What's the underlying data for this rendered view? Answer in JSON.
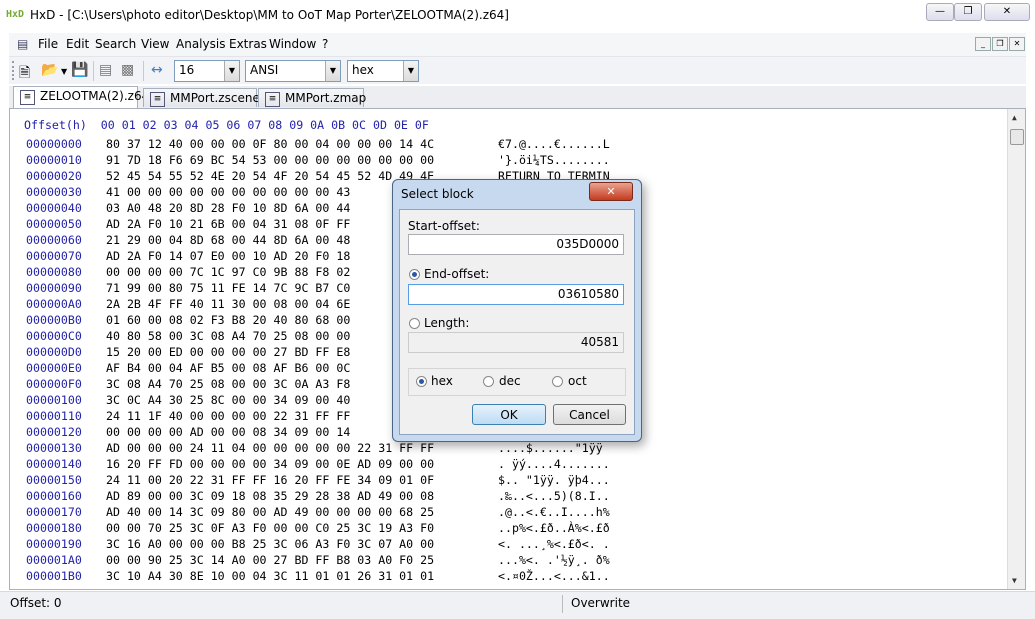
{
  "window": {
    "app_icon": "HxD",
    "title": "HxD - [C:\\Users\\photo editor\\Desktop\\MM to OoT Map Porter\\ZELOOTMA(2).z64]",
    "controls": [
      "minimize-icon",
      "restore-icon",
      "close-icon"
    ]
  },
  "menu": {
    "items": [
      "File",
      "Edit",
      "Search",
      "View",
      "Analysis",
      "Extras",
      "Window",
      "?"
    ]
  },
  "toolbar": {
    "bytes_per_row": "16",
    "charset": "ANSI",
    "offset_base": "hex"
  },
  "tabs": [
    {
      "label": "ZELOOTMA(2).z64",
      "active": true
    },
    {
      "label": "MMPort.zscene",
      "active": false
    },
    {
      "label": "MMPort.zmap",
      "active": false
    }
  ],
  "editor": {
    "header": "Offset(h)  00 01 02 03 04 05 06 07 08 09 0A 0B 0C 0D 0E 0F",
    "rows": [
      {
        "offset": "00000000",
        "hex": "80 37 12 40 00 00 00 0F 80 00 04 00 00 00 14 4C",
        "ascii": "€7.@....€......L"
      },
      {
        "offset": "00000010",
        "hex": "91 7D 18 F6 69 BC 54 53 00 00 00 00 00 00 00 00",
        "ascii": "'}.öi¼TS........"
      },
      {
        "offset": "00000020",
        "hex": "52 45 54 55 52 4E 20 54 4F 20 54 45 52 4D 49 4E",
        "ascii": "RETURN TO TERMIN"
      },
      {
        "offset": "00000030",
        "hex": "41 00 00 00 00 00 00 00 00 00 00 43",
        "ascii": ""
      },
      {
        "offset": "00000040",
        "hex": "03 A0 48 20 8D 28 F0 10 8D 6A 00 44",
        "ascii": ""
      },
      {
        "offset": "00000050",
        "hex": "AD 2A F0 10 21 6B 00 04 31 08 0F FF",
        "ascii": ""
      },
      {
        "offset": "00000060",
        "hex": "21 29 00 04 8D 68 00 44 8D 6A 00 48",
        "ascii": ""
      },
      {
        "offset": "00000070",
        "hex": "AD 2A F0 14 07 E0 00 10 AD 20 F0 18",
        "ascii": ""
      },
      {
        "offset": "00000080",
        "hex": "00 00 00 00 7C 1C 97 C0 9B 88 F8 02",
        "ascii": ""
      },
      {
        "offset": "00000090",
        "hex": "71 99 00 80 75 11 FE 14 7C 9C B7 C0",
        "ascii": ""
      },
      {
        "offset": "000000A0",
        "hex": "2A 2B 4F FF 40 11 30 00 08 00 04 6E",
        "ascii": ""
      },
      {
        "offset": "000000B0",
        "hex": "01 60 00 08 02 F3 B8 20 40 80 68 00",
        "ascii": ""
      },
      {
        "offset": "000000C0",
        "hex": "40 80 58 00 3C 08 A4 70 25 08 00 00",
        "ascii": ""
      },
      {
        "offset": "000000D0",
        "hex": "15 20 00 ED 00 00 00 00 27 BD FF E8",
        "ascii": ""
      },
      {
        "offset": "000000E0",
        "hex": "AF B4 00 04 AF B5 00 08 AF B6 00 0C",
        "ascii": ""
      },
      {
        "offset": "000000F0",
        "hex": "3C 08 A4 70 25 08 00 00 3C 0A A3 F8",
        "ascii": ""
      },
      {
        "offset": "00000100",
        "hex": "3C 0C A4 30 25 8C 00 00 34 09 00 40",
        "ascii": ""
      },
      {
        "offset": "00000110",
        "hex": "24 11 1F 40 00 00 00 00 22 31 FF FF",
        "ascii": ""
      },
      {
        "offset": "00000120",
        "hex": "00 00 00 00 AD 00 00 08 34 09 00 14",
        "ascii": ""
      },
      {
        "offset": "00000130",
        "hex": "AD 00 00 00 24 11 04 00 00 00 00 00 22 31 FF FF",
        "ascii": "....$......\"1ÿÿ"
      },
      {
        "offset": "00000140",
        "hex": "16 20 FF FD 00 00 00 00 34 09 00 0E AD 09 00 00",
        "ascii": ". ÿý....4......."
      },
      {
        "offset": "00000150",
        "hex": "24 11 00 20 22 31 FF FF 16 20 FF FE 34 09 01 0F",
        "ascii": "$.. \"1ÿÿ. ÿþ4..."
      },
      {
        "offset": "00000160",
        "hex": "AD 89 00 00 3C 09 18 08 35 29 28 38 AD 49 00 08",
        "ascii": ".‰..<...5)(8.I.."
      },
      {
        "offset": "00000170",
        "hex": "AD 40 00 14 3C 09 80 00 AD 49 00 00 00 00 68 25",
        "ascii": ".@..<.€..I....h%"
      },
      {
        "offset": "00000180",
        "hex": "00 00 70 25 3C 0F A3 F0 00 00 C0 25 3C 19 A3 F0",
        "ascii": "..p%<.£ð..À%<.£ð"
      },
      {
        "offset": "00000190",
        "hex": "3C 16 A0 00 00 00 B8 25 3C 06 A3 F0 3C 07 A0 00",
        "ascii": "<. ...¸%<.£ð<. ."
      },
      {
        "offset": "000001A0",
        "hex": "00 00 90 25 3C 14 A0 00 27 BD FF B8 03 A0 F0 25",
        "ascii": "...%<. .'½ÿ¸. ð%"
      },
      {
        "offset": "000001B0",
        "hex": "3C 10 A4 30 8E 10 00 04 3C 11 01 01 26 31 01 01",
        "ascii": "<.¤0Ž...<...&1.."
      }
    ]
  },
  "status": {
    "offset": "Offset: 0",
    "mode": "Overwrite"
  },
  "dialog": {
    "title": "Select block",
    "start_label": "Start-offset:",
    "start_value": "035D0000",
    "end_label": "End-offset:",
    "end_value": "03610580",
    "length_label": "Length:",
    "length_value": "40581",
    "selected_mode": "End-offset",
    "bases": [
      "hex",
      "dec",
      "oct"
    ],
    "selected_base": "hex",
    "ok": "OK",
    "cancel": "Cancel"
  }
}
